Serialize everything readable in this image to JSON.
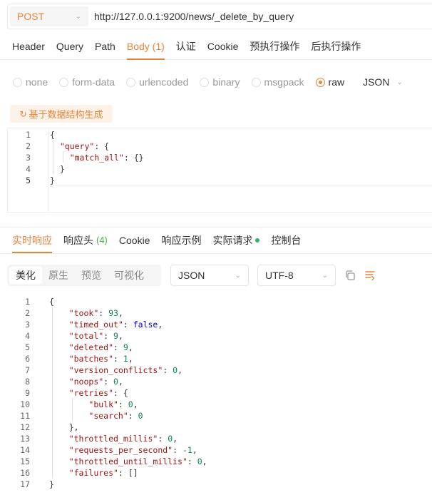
{
  "request": {
    "method": "POST",
    "url": "http://127.0.0.1:9200/news/_delete_by_query"
  },
  "request_tabs": [
    {
      "label": "Header"
    },
    {
      "label": "Query"
    },
    {
      "label": "Path"
    },
    {
      "label": "Body",
      "count": "(1)",
      "active": true
    },
    {
      "label": "认证"
    },
    {
      "label": "Cookie"
    },
    {
      "label": "预执行操作"
    },
    {
      "label": "后执行操作"
    }
  ],
  "body_types": [
    {
      "label": "none"
    },
    {
      "label": "form-data"
    },
    {
      "label": "urlencoded"
    },
    {
      "label": "binary"
    },
    {
      "label": "msgpack"
    },
    {
      "label": "raw",
      "selected": true
    }
  ],
  "body_format": "JSON",
  "generate_button": "基于数据结构生成",
  "request_body": [
    {
      "ln": "1",
      "text": "{"
    },
    {
      "ln": "2",
      "text": "  \"query\": {"
    },
    {
      "ln": "3",
      "text": "    \"match_all\": {}"
    },
    {
      "ln": "4",
      "text": "  }"
    },
    {
      "ln": "5",
      "text": "}"
    }
  ],
  "response_tabs": [
    {
      "label": "实时响应",
      "active": true
    },
    {
      "label": "响应头",
      "count": "(4)"
    },
    {
      "label": "Cookie"
    },
    {
      "label": "响应示例"
    },
    {
      "label": "实际请求",
      "dot": true
    },
    {
      "label": "控制台"
    }
  ],
  "view_modes": [
    {
      "label": "美化",
      "selected": true
    },
    {
      "label": "原生"
    },
    {
      "label": "预览"
    },
    {
      "label": "可视化"
    }
  ],
  "response_format": "JSON",
  "response_encoding": "UTF-8",
  "response_body": [
    {
      "ln": "1",
      "text": "{"
    },
    {
      "ln": "2",
      "text": "    \"took\": 93,"
    },
    {
      "ln": "3",
      "text": "    \"timed_out\": false,"
    },
    {
      "ln": "4",
      "text": "    \"total\": 9,"
    },
    {
      "ln": "5",
      "text": "    \"deleted\": 9,"
    },
    {
      "ln": "6",
      "text": "    \"batches\": 1,"
    },
    {
      "ln": "7",
      "text": "    \"version_conflicts\": 0,"
    },
    {
      "ln": "8",
      "text": "    \"noops\": 0,"
    },
    {
      "ln": "9",
      "text": "    \"retries\": {"
    },
    {
      "ln": "10",
      "text": "        \"bulk\": 0,"
    },
    {
      "ln": "11",
      "text": "        \"search\": 0"
    },
    {
      "ln": "12",
      "text": "    },"
    },
    {
      "ln": "13",
      "text": "    \"throttled_millis\": 0,"
    },
    {
      "ln": "14",
      "text": "    \"requests_per_second\": -1,"
    },
    {
      "ln": "15",
      "text": "    \"throttled_until_millis\": 0,"
    },
    {
      "ln": "16",
      "text": "    \"failures\": []"
    },
    {
      "ln": "17",
      "text": "}"
    }
  ],
  "colors": {
    "accent": "#e8833a",
    "key": "#a31515",
    "number": "#098658",
    "keyword": "#0000ff",
    "success": "#2fb36a"
  }
}
